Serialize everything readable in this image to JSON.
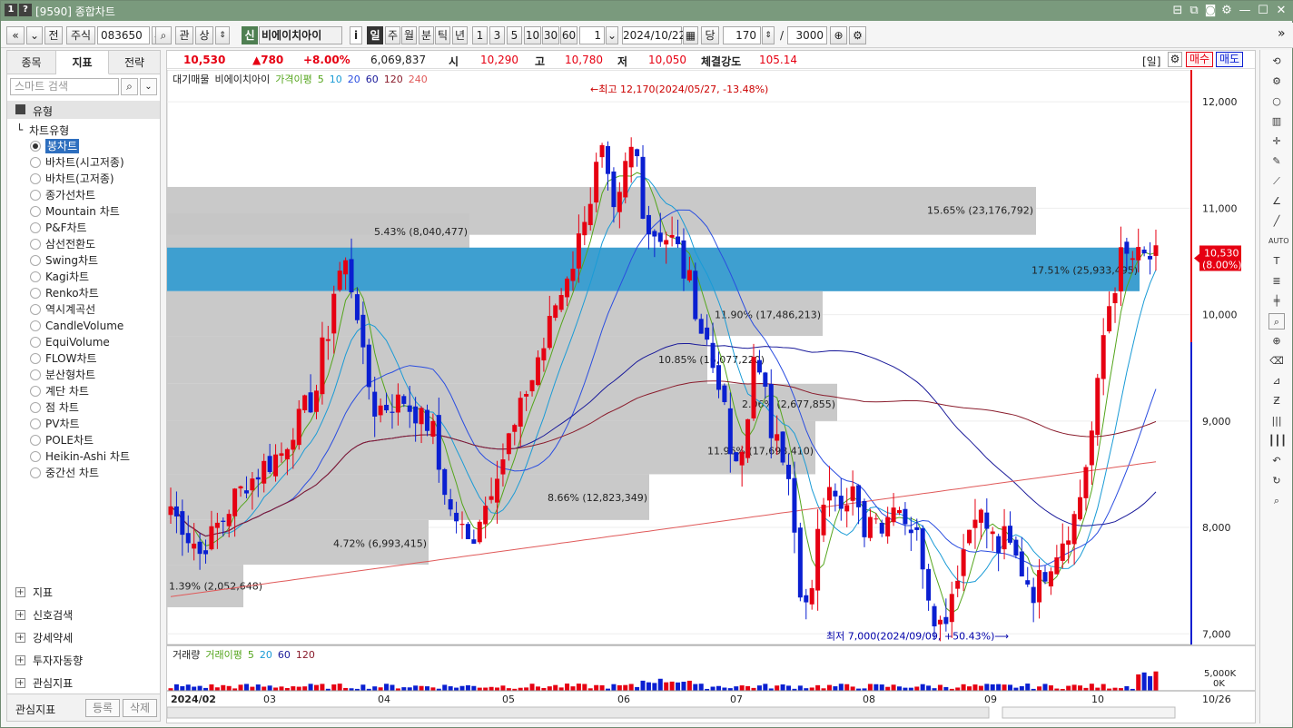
{
  "window": {
    "number": "1",
    "help": "?",
    "title": "[9590] 종합차트"
  },
  "toolbar": {
    "nav_prev": "«",
    "nav_next": "»",
    "market": "전",
    "asset_type": "주식",
    "code": "083650",
    "search_icon": "search-icon",
    "watch": "관",
    "up": "상",
    "credit_badge": "신",
    "stock_name": "비에이치아이",
    "info": "i",
    "periods": [
      "일",
      "주",
      "월",
      "분",
      "틱",
      "년"
    ],
    "active_period": "일",
    "intervals": [
      "1",
      "3",
      "5",
      "10",
      "30",
      "60"
    ],
    "interval_value": "1",
    "date": "2024/10/22",
    "count_label": "당",
    "count": "170",
    "slash": "/",
    "total": "3000"
  },
  "left_panel": {
    "tabs": [
      "종목",
      "지표",
      "전략"
    ],
    "active_tab": "지표",
    "search_placeholder": "스마트 검색",
    "type_header": "유형",
    "chart_type_group": "차트유형",
    "chart_types": [
      "봉차트",
      "바차트(시고저종)",
      "바차트(고저종)",
      "종가선차트",
      "Mountain 차트",
      "P&F차트",
      "삼선전환도",
      "Swing차트",
      "Kagi차트",
      "Renko차트",
      "역시계곡선",
      "CandleVolume",
      "EquiVolume",
      "FLOW차트",
      "분산형차트",
      "계단 차트",
      "점 차트",
      "PV차트",
      "POLE차트",
      "Heikin-Ashi 차트",
      "중간선 차트"
    ],
    "selected_type": "봉차트",
    "sections": [
      "지표",
      "신호검색",
      "강세약세",
      "투자자동향",
      "관심지표"
    ],
    "footer_label": "관심지표",
    "register": "등록",
    "delete": "삭제"
  },
  "price_bar": {
    "price": "10,530",
    "change": "▲780",
    "change_pct": "+8.00%",
    "volume": "6,069,837",
    "open_label": "시",
    "open": "10,290",
    "high_label": "고",
    "high": "10,780",
    "low_label": "저",
    "low": "10,050",
    "strength_label": "체결강도",
    "strength": "105.14",
    "period_badge": "[일]",
    "buy": "매수",
    "sell": "매도"
  },
  "legend": {
    "overlay": "대기매물",
    "stock": "비에이치아이",
    "ma_label": "가격이평",
    "ma_periods": [
      "5",
      "10",
      "20",
      "60",
      "120",
      "240"
    ]
  },
  "vol_legend": {
    "title": "거래량",
    "ma_label": "거래이평",
    "periods": [
      "5",
      "20",
      "60",
      "120"
    ]
  },
  "colors": {
    "up": "#e60012",
    "down": "#0a1fd1",
    "ma5": "#54a51c",
    "ma10": "#1a9bd6",
    "ma20": "#2a4de0",
    "ma60": "#1a1a9a",
    "ma120": "#8a1c2c",
    "ma240": "#e05a5a",
    "band": "#c6c6c6",
    "band_hl": "#3e9fd0"
  },
  "chart_data": {
    "type": "candlestick",
    "ylim": [
      6900,
      12300
    ],
    "y_ticks": [
      "12,000",
      "11,000",
      "10,000",
      "9,000",
      "8,000",
      "7,000"
    ],
    "x_ticks": [
      "2024/02",
      "03",
      "04",
      "05",
      "06",
      "07",
      "08",
      "09",
      "10"
    ],
    "last_date": "10/26",
    "current_price": "10,530",
    "current_pct": "(8.00%)",
    "high_annotation": "←최고 12,170(2024/05/27, -13.48%)",
    "low_annotation": "최저 7,000(2024/09/09, +50.43%)⟶",
    "volume_ticks": [
      "5,000K",
      "0K"
    ],
    "volume_profile": [
      {
        "label": "15.65% (23,176,792)",
        "low": 10750,
        "high": 11200
      },
      {
        "label": "5.43% (8,040,477)",
        "low": 10550,
        "high": 10950
      },
      {
        "label": "17.51% (25,933,495)",
        "low": 10220,
        "high": 10630,
        "highlight": true
      },
      {
        "label": "11.90% (17,486,213)",
        "low": 9800,
        "high": 10220
      },
      {
        "label": "10.85% (16,077,220)",
        "low": 9350,
        "high": 9800
      },
      {
        "label": "2.06% (2,677,855)",
        "low": 9000,
        "high": 9350
      },
      {
        "label": "11.96% (17,698,410)",
        "low": 8500,
        "high": 9000
      },
      {
        "label": "8.66% (12,823,349)",
        "low": 8070,
        "high": 8500
      },
      {
        "label": "4.72% (6,993,415)",
        "low": 7650,
        "high": 8070
      },
      {
        "label": "1.39% (2,052,648)",
        "low": 7250,
        "high": 7650
      }
    ]
  }
}
